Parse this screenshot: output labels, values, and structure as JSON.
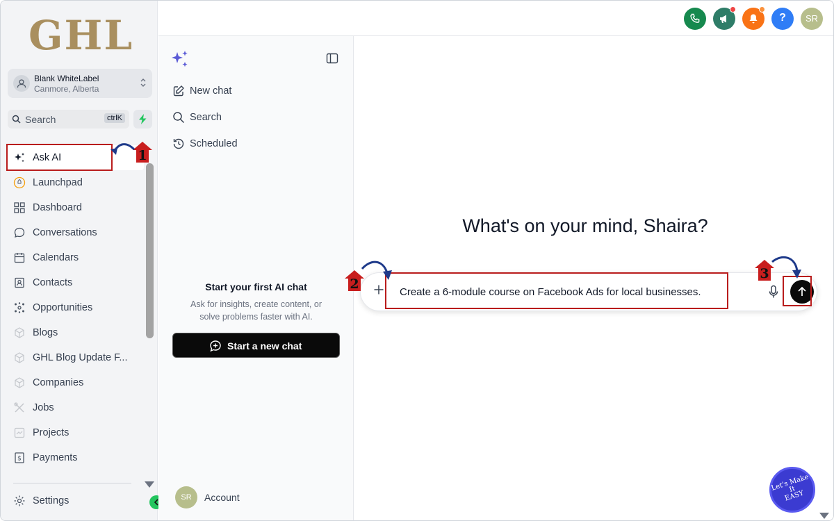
{
  "brand": {
    "logo_text": "GHL"
  },
  "account_switcher": {
    "name": "Blank WhiteLabel",
    "location": "Canmore, Alberta"
  },
  "sidebar_search": {
    "label": "Search",
    "shortcut": "ctrlK"
  },
  "sidebar": {
    "items": [
      {
        "label": "Ask AI",
        "icon": "sparkles-icon"
      },
      {
        "label": "Launchpad",
        "icon": "rocket-icon"
      },
      {
        "label": "Dashboard",
        "icon": "grid-icon"
      },
      {
        "label": "Conversations",
        "icon": "chat-bubble-icon"
      },
      {
        "label": "Calendars",
        "icon": "calendar-icon"
      },
      {
        "label": "Contacts",
        "icon": "contacts-icon"
      },
      {
        "label": "Opportunities",
        "icon": "opportunities-icon"
      },
      {
        "label": "Blogs",
        "icon": "cube-icon"
      },
      {
        "label": "GHL Blog Update F...",
        "icon": "cube-icon"
      },
      {
        "label": "Companies",
        "icon": "cube-icon"
      },
      {
        "label": "Jobs",
        "icon": "tools-icon"
      },
      {
        "label": "Projects",
        "icon": "projects-icon"
      },
      {
        "label": "Payments",
        "icon": "payments-icon"
      }
    ],
    "settings_label": "Settings"
  },
  "header": {
    "avatar_initials": "SR",
    "help_label": "?"
  },
  "ai_panel": {
    "new_chat_label": "New chat",
    "search_label": "Search",
    "scheduled_label": "Scheduled",
    "empty_title": "Start your first AI chat",
    "empty_desc": "Ask for insights, create content, or solve problems faster with AI.",
    "start_button_label": "Start a new chat",
    "account_initials": "SR",
    "account_label": "Account"
  },
  "main": {
    "greeting": "What's on your mind, Shaira?",
    "prompt_value": "Create a 6-module course on Facebook Ads for local businesses."
  },
  "annotations": {
    "step1": "1",
    "step2": "2",
    "step3": "3"
  },
  "fab": {
    "line1": "Let's Make",
    "line2": "It",
    "line3": "EASY"
  },
  "colors": {
    "accent_green": "#16894e",
    "notification_orange": "#f97316",
    "help_blue": "#2f7df6",
    "annotation_red": "#b91c1c",
    "annotation_arrow": "#1e3a8a"
  }
}
